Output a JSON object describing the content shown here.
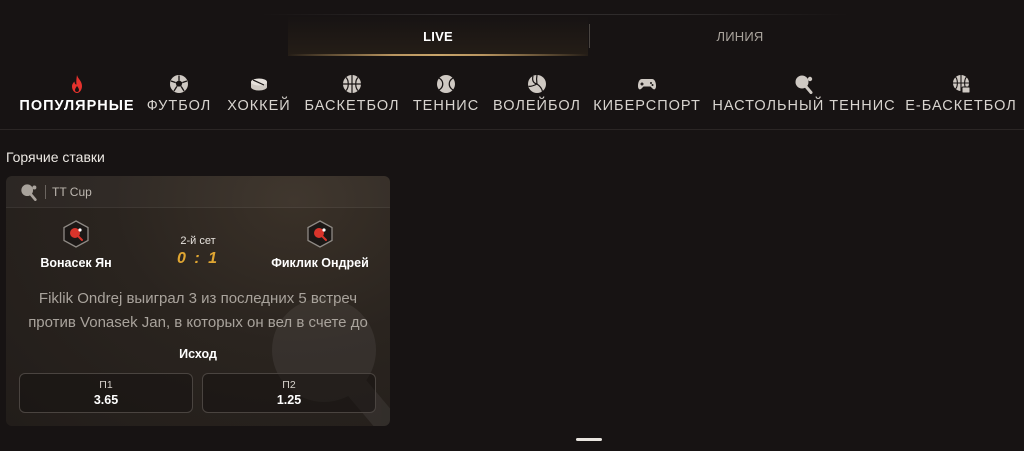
{
  "mode_tabs": {
    "live": "LIVE",
    "line": "ЛИНИЯ"
  },
  "sports": [
    {
      "label": "ПОПУЛЯРНЫЕ",
      "icon": "fire-icon",
      "active": true
    },
    {
      "label": "ФУТБОЛ",
      "icon": "soccer-ball-icon"
    },
    {
      "label": "ХОККЕЙ",
      "icon": "hockey-puck-icon"
    },
    {
      "label": "БАСКЕТБОЛ",
      "icon": "basketball-icon"
    },
    {
      "label": "ТЕННИС",
      "icon": "tennis-ball-icon"
    },
    {
      "label": "ВОЛЕЙБОЛ",
      "icon": "volleyball-icon"
    },
    {
      "label": "КИБЕРСПОРТ",
      "icon": "gamepad-icon"
    },
    {
      "label": "НАСТОЛЬНЫЙ ТЕННИС",
      "icon": "table-tennis-icon"
    },
    {
      "label": "Е-БАСКЕТБОЛ",
      "icon": "e-basketball-icon"
    }
  ],
  "section": {
    "title": "Горячие ставки"
  },
  "card": {
    "league": "TT Cup",
    "league_icon": "table-tennis-icon",
    "home_team": "Вонасек Ян",
    "away_team": "Фиклик Ондрей",
    "period": "2-й сет",
    "score": "0 : 1",
    "insight": "Fiklik Ondrej выиграл 3 из последних 5 встреч против Vonasek Jan, в которых он вел в счете до",
    "market": "Исход",
    "odds": [
      {
        "label": "П1",
        "value": "3.65"
      },
      {
        "label": "П2",
        "value": "1.25"
      }
    ]
  },
  "colors": {
    "background": "#171313",
    "accent_gold": "#c9a56b",
    "score_orange": "#e0a632",
    "fire_red": "#e5322d"
  }
}
